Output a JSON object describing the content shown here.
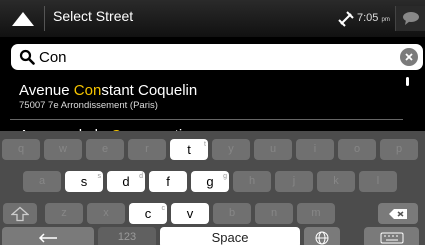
{
  "header": {
    "title": "Select Street",
    "time": "7:05",
    "time_suffix": "pm"
  },
  "search": {
    "value": "Con"
  },
  "results": [
    {
      "prefix": "Avenue ",
      "highlight": "Con",
      "suffix": "stant Coquelin",
      "subtitle": "75007 7e Arrondissement (Paris)"
    },
    {
      "prefix": "Avenue de la ",
      "highlight": "Con",
      "suffix": "servation",
      "subtitle": ""
    }
  ],
  "keyboard": {
    "row1": [
      {
        "label": "q",
        "active": false
      },
      {
        "label": "w",
        "active": false
      },
      {
        "label": "e",
        "active": false
      },
      {
        "label": "r",
        "active": false
      },
      {
        "label": "t",
        "active": true,
        "sup": "t"
      },
      {
        "label": "y",
        "active": false
      },
      {
        "label": "u",
        "active": false
      },
      {
        "label": "i",
        "active": false
      },
      {
        "label": "o",
        "active": false
      },
      {
        "label": "p",
        "active": false
      }
    ],
    "row2": [
      {
        "label": "a",
        "active": false
      },
      {
        "label": "s",
        "active": true,
        "sup": "s"
      },
      {
        "label": "d",
        "active": true,
        "sup": "d"
      },
      {
        "label": "f",
        "active": true,
        "sup": ""
      },
      {
        "label": "g",
        "active": true,
        "sup": "g"
      },
      {
        "label": "h",
        "active": false
      },
      {
        "label": "j",
        "active": false
      },
      {
        "label": "k",
        "active": false
      },
      {
        "label": "l",
        "active": false
      }
    ],
    "row3": [
      {
        "label": "z",
        "active": false
      },
      {
        "label": "x",
        "active": false
      },
      {
        "label": "c",
        "active": true,
        "sup": "c"
      },
      {
        "label": "v",
        "active": true,
        "sup": ""
      },
      {
        "label": "b",
        "active": false
      },
      {
        "label": "n",
        "active": false
      },
      {
        "label": "m",
        "active": false
      }
    ],
    "number_label": "123",
    "space_label": "Space"
  },
  "icons": {
    "back": "triangle-up-icon",
    "satellite": "satellite-icon",
    "message": "speech-bubble-icon",
    "search": "magnifier-icon",
    "clear": "clear-x-icon",
    "shift": "shift-arrow-icon",
    "backspace": "backspace-icon",
    "enter": "left-arrow-icon",
    "globe": "globe-icon",
    "hide_keyboard": "keyboard-icon"
  },
  "colors": {
    "highlight": "#f5c400",
    "topbar": "#1e1e1e",
    "keyboard_bg": "#4c4c4c"
  }
}
